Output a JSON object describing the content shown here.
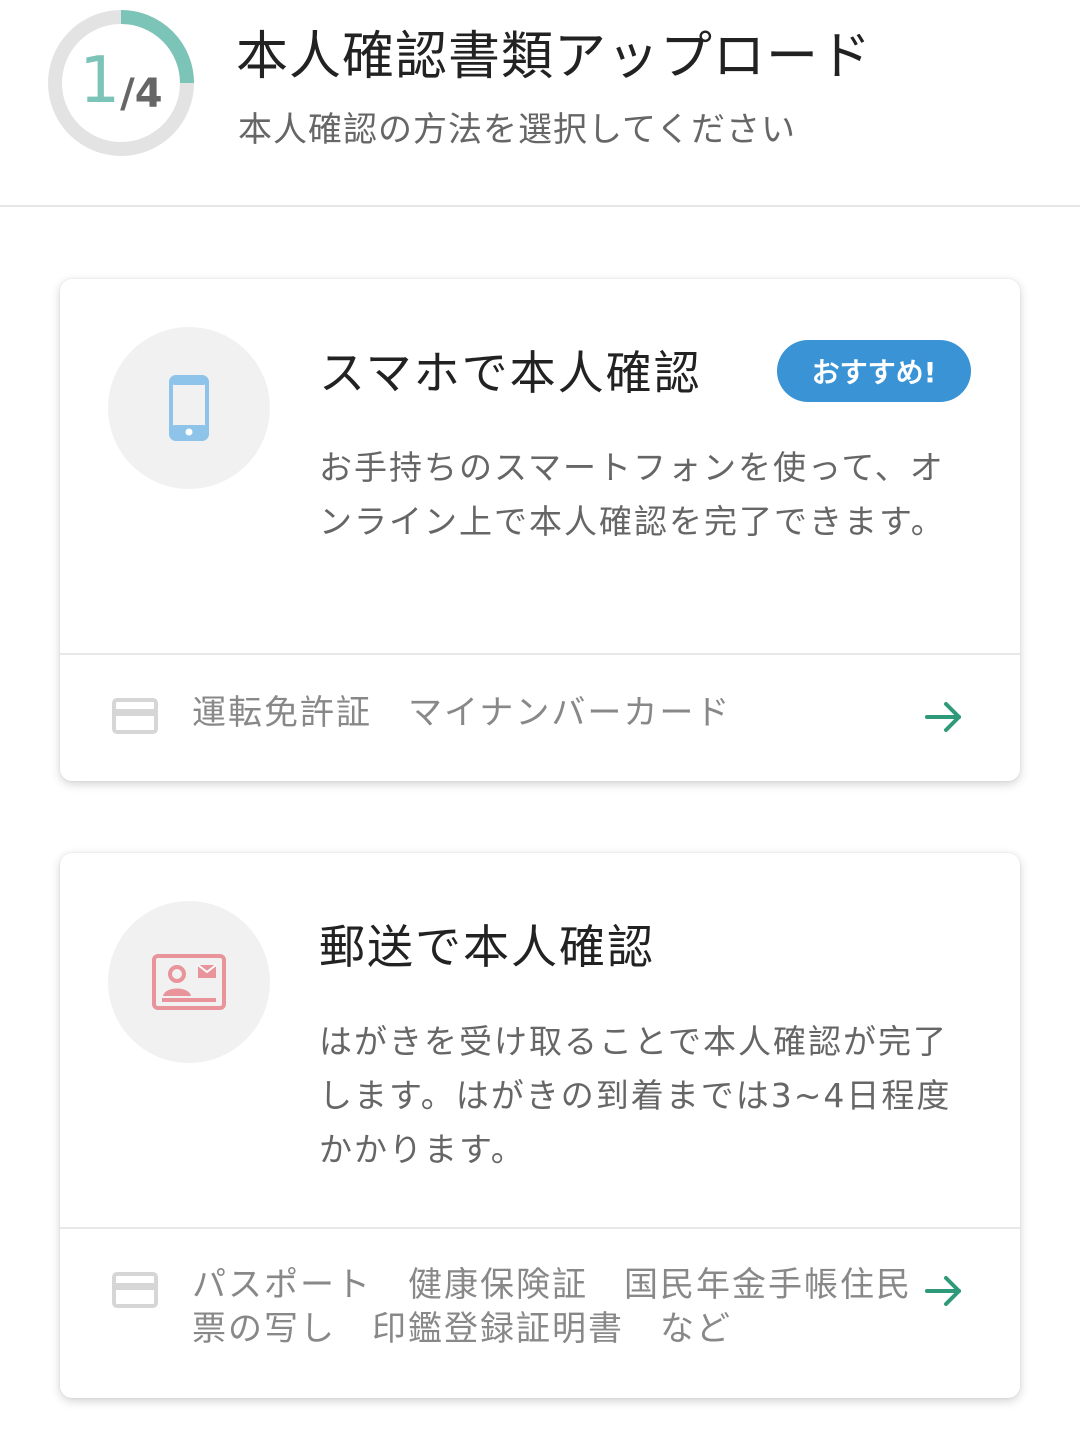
{
  "header": {
    "progress_current": "1",
    "progress_total": "/4",
    "progress_fraction": 0.25,
    "title": "本人確認書類アップロード",
    "subtitle": "本人確認の方法を選択してください"
  },
  "options": [
    {
      "title": "スマホで本人確認",
      "badge": "おすすめ!",
      "description": "お手持ちのスマートフォンを使って、オンライン上で本人確認を完了できます。",
      "documents": "運転免許証　マイナンバーカード",
      "icon": "smartphone-icon"
    },
    {
      "title": "郵送で本人確認",
      "description": "はがきを受け取ることで本人確認が完了します。はがきの到着までは3~4日程度かかります。",
      "documents": "パスポート　健康保険証　国民年金手帳住民票の写し　印鑑登録証明書　など",
      "icon": "postcard-id-icon"
    }
  ],
  "colors": {
    "progress_accent": "#7cc3b8",
    "badge": "#3a93d5",
    "phone_icon": "#8ec3ea",
    "postcard_icon": "#e9939a",
    "arrow": "#2e9a7a"
  }
}
